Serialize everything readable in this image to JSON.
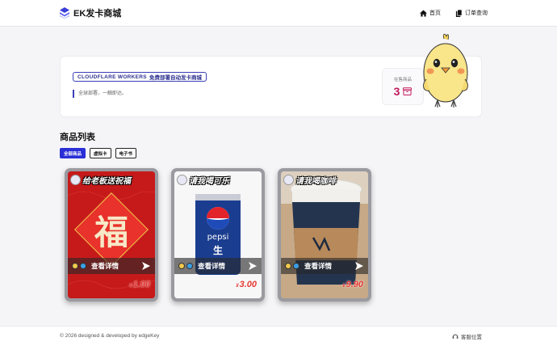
{
  "header": {
    "brand": "EK发卡商城",
    "nav": [
      {
        "label": "首页",
        "icon": "home-icon"
      },
      {
        "label": "订单查询",
        "icon": "order-icon"
      }
    ]
  },
  "hero": {
    "badge": "CLOUDFLARE WORKERS",
    "badge_sub": "免费部署自动发卡商城",
    "description": "全球部署，一触即达。",
    "stock_label": "在售商品",
    "stock_count": "3",
    "stock_icon": "box-icon",
    "mascot": "chick-mascot"
  },
  "products": {
    "title": "商品列表",
    "tabs": [
      "全部商品",
      "虚拟卡",
      "电子书"
    ],
    "active_tab": 0,
    "items": [
      {
        "title": "给老板送祝福",
        "action": "查看详情",
        "currency": "¥",
        "price": "1.00",
        "theme": "red-fu"
      },
      {
        "title": "请我喝可乐",
        "action": "查看详情",
        "currency": "¥",
        "price": "3.00",
        "theme": "pepsi"
      },
      {
        "title": "请我喝咖啡",
        "action": "查看详情",
        "currency": "¥",
        "price": "9.90",
        "theme": "coffee"
      }
    ]
  },
  "footer": {
    "copyright": "© 2026 designed & developed by edgeKey",
    "service": "客服位置"
  }
}
